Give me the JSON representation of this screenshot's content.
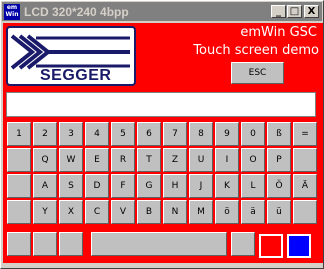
{
  "window": {
    "title": "LCD 320*240 4bpp",
    "icon_text_top": "em",
    "icon_text_bottom": "Win",
    "minimize_label": "_",
    "maximize_label": "□",
    "close_label": "X"
  },
  "header": {
    "logo_text": "SEGGER",
    "line1": "emWin GSC",
    "line2": "Touch screen demo",
    "esc_label": "ESC"
  },
  "input": {
    "value": ""
  },
  "keyboard": {
    "row1": [
      "1",
      "2",
      "3",
      "4",
      "5",
      "6",
      "7",
      "8",
      "9",
      "0",
      "ß",
      "="
    ],
    "row2": [
      "",
      "Q",
      "W",
      "E",
      "R",
      "T",
      "Z",
      "U",
      "I",
      "O",
      "P",
      ""
    ],
    "row3": [
      "",
      "A",
      "S",
      "D",
      "F",
      "G",
      "H",
      "J",
      "K",
      "L",
      "Ö",
      "Ä"
    ],
    "row4": [
      "",
      "Y",
      "X",
      "C",
      "V",
      "B",
      "N",
      "M",
      "ö",
      "ä",
      "ü",
      ""
    ],
    "row5_left": [
      "",
      ""
    ],
    "row5_right": [
      "",
      ""
    ],
    "space": ""
  },
  "colors": {
    "background": "#ff0000",
    "swatch_red": "#ff0000",
    "swatch_blue": "#0000ff"
  }
}
